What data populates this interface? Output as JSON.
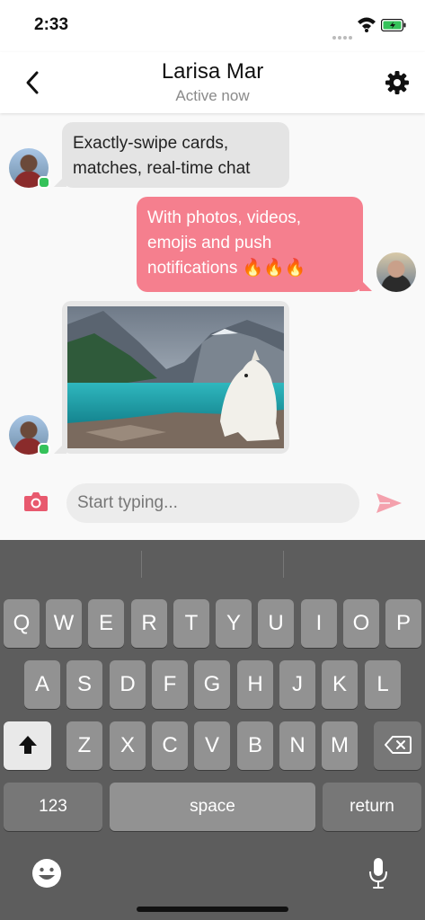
{
  "status_bar": {
    "time": "2:33"
  },
  "header": {
    "name": "Larisa Mar",
    "status": "Active now"
  },
  "messages": [
    {
      "sender": "Larisa Mar",
      "direction": "incoming",
      "text": "Exactly-swipe cards, matches, real-time chat"
    },
    {
      "sender": "me",
      "direction": "outgoing",
      "text": "With photos, videos, emojis and push notifications 🔥🔥🔥"
    },
    {
      "sender": "Larisa Mar",
      "direction": "incoming",
      "type": "image",
      "image_subject": "white dog by a turquoise mountain lake"
    }
  ],
  "composer": {
    "placeholder": "Start typing..."
  },
  "keyboard": {
    "row1": [
      "Q",
      "W",
      "E",
      "R",
      "T",
      "Y",
      "U",
      "I",
      "O",
      "P"
    ],
    "row2": [
      "A",
      "S",
      "D",
      "F",
      "G",
      "H",
      "J",
      "K",
      "L"
    ],
    "row3": [
      "Z",
      "X",
      "C",
      "V",
      "B",
      "N",
      "M"
    ],
    "numbers_label": "123",
    "space_label": "space",
    "return_label": "return"
  },
  "colors": {
    "accent": "#f57f8e",
    "incoming_bubble": "#e4e4e4",
    "online": "#35c25a",
    "keyboard_bg": "#5d5d5d"
  },
  "icons": [
    "back-chevron-icon",
    "gear-icon",
    "camera-icon",
    "send-icon",
    "shift-icon",
    "backspace-icon",
    "emoji-icon",
    "microphone-icon"
  ]
}
